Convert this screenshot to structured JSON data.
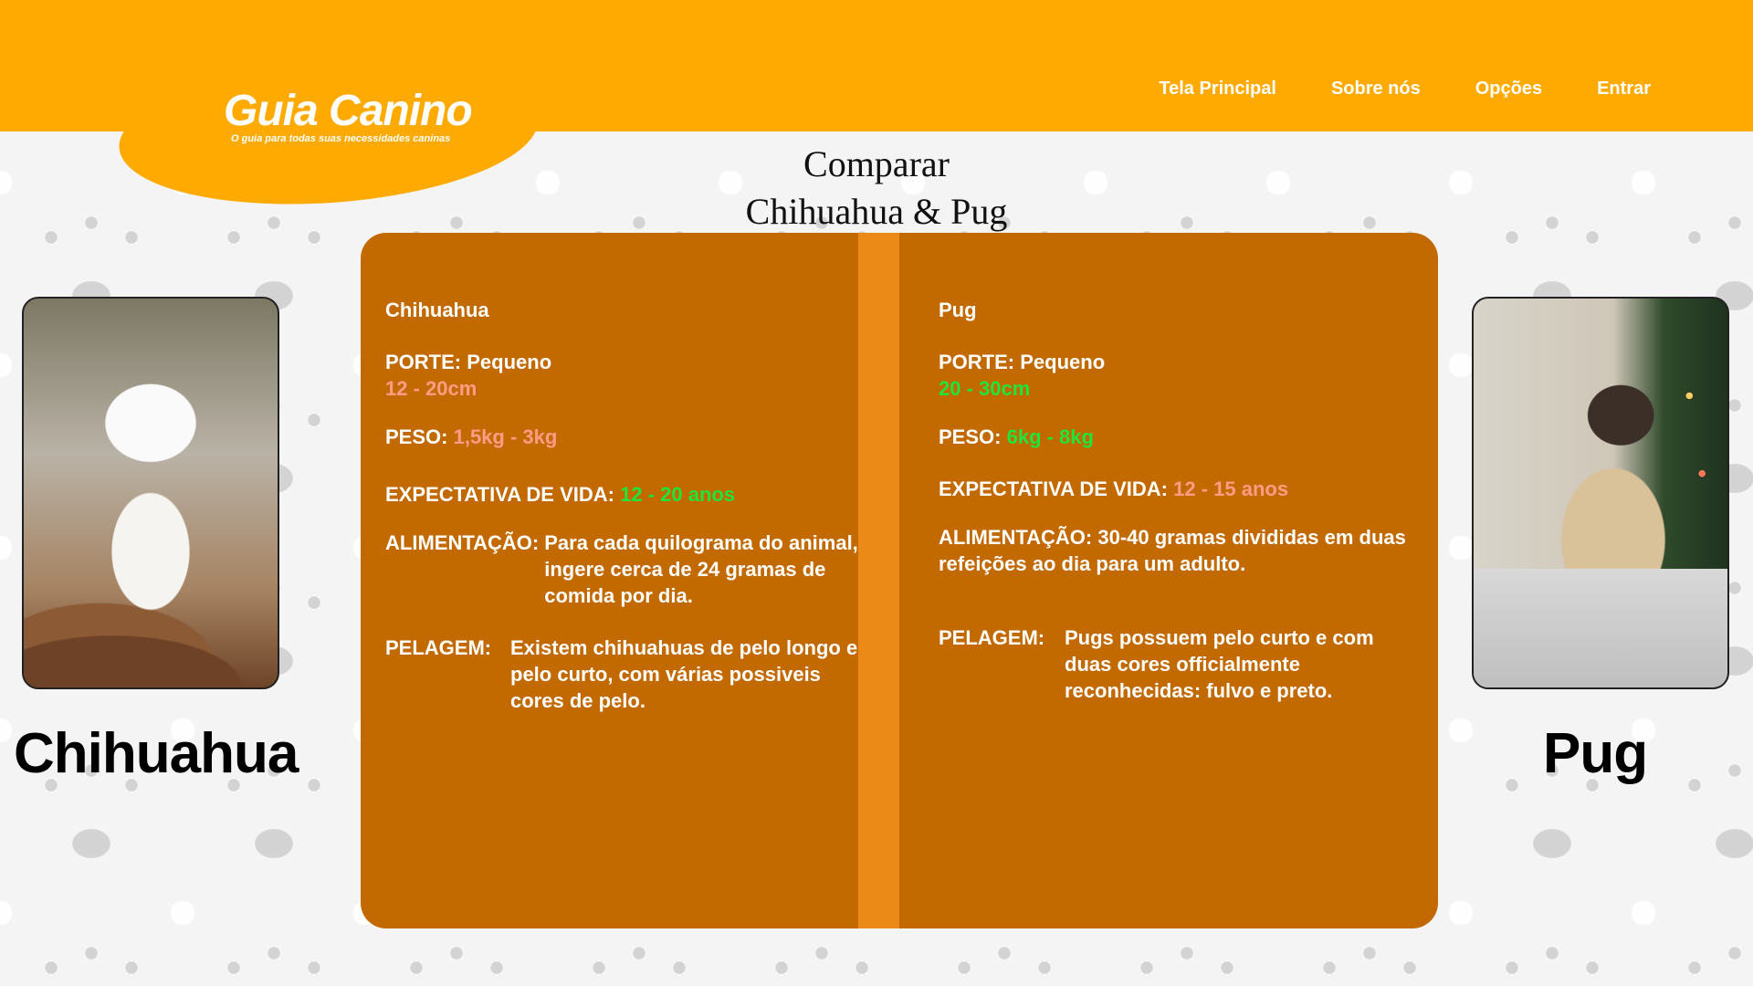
{
  "header": {
    "brand_title": "Guia Canino",
    "brand_subtitle": "O guia para todas suas necessidades caninas",
    "nav": [
      "Tela Principal",
      "Sobre nós",
      "Opções",
      "Entrar"
    ]
  },
  "page": {
    "title_line1": "Comparar",
    "title_line2": "Chihuahua & Pug"
  },
  "dogs": {
    "left_name": "Chihuahua",
    "right_name": "Pug"
  },
  "compare": {
    "left": {
      "name": "Chihuahua",
      "porte_label": "PORTE:",
      "porte_value": "Pequeno",
      "height": "12 - 20cm",
      "peso_label": "PESO:",
      "peso_value": "1,5kg - 3kg",
      "vida_label": "EXPECTATIVA DE VIDA:",
      "vida_value": "12 - 20 anos",
      "alim_label": "ALIMENTAÇÃO:",
      "alim_value": "Para cada quilograma do animal, ingere cerca de 24 gramas de comida por dia.",
      "pelagem_label": "PELAGEM:",
      "pelagem_value": "Existem chihuahuas de pelo longo e pelo curto, com várias possiveis cores de pelo."
    },
    "right": {
      "name": "Pug",
      "porte_label": "PORTE:",
      "porte_value": "Pequeno",
      "height": "20 - 30cm",
      "peso_label": "PESO:",
      "peso_value": "6kg - 8kg",
      "vida_label": "EXPECTATIVA DE VIDA:",
      "vida_value": "12 - 15 anos",
      "alim_label": "ALIMENTAÇÃO:",
      "alim_value": "30-40 gramas divididas em duas refeições ao dia para um adulto.",
      "pelagem_label": "PELAGEM:",
      "pelagem_value": "Pugs possuem pelo curto e com duas cores officialmente reconhecidas: fulvo e preto."
    }
  },
  "colors": {
    "header": "#ffaa00",
    "panel": "#c26900",
    "divider": "#ec8a18",
    "better": "#22e33a",
    "worse": "#ff9c86"
  }
}
